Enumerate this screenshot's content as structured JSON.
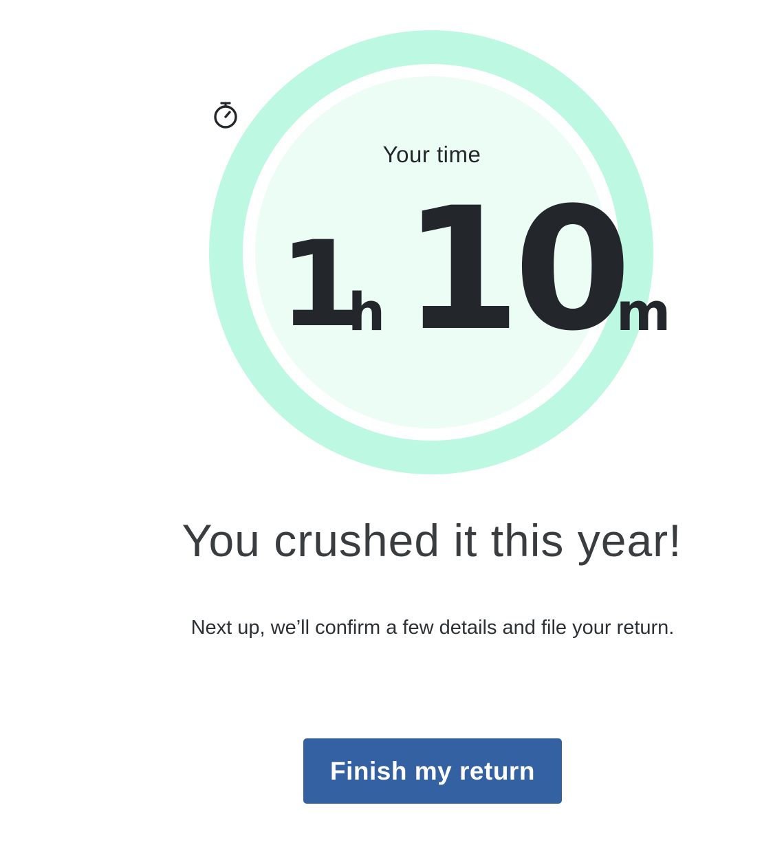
{
  "timer": {
    "icon": "stopwatch-icon",
    "label": "Your time",
    "hours": "1",
    "hours_unit": "h",
    "minutes": "10",
    "minutes_unit": "m"
  },
  "message": {
    "headline": "You crushed it this year!",
    "subtext": "Next up, we’ll confirm a few details and file your return."
  },
  "actions": {
    "primary_label": "Finish my return"
  },
  "colors": {
    "ring": "#bdf8e2",
    "inner_fill": "#ecfdf5",
    "button": "#3361a1",
    "text_dark": "#23272b"
  }
}
